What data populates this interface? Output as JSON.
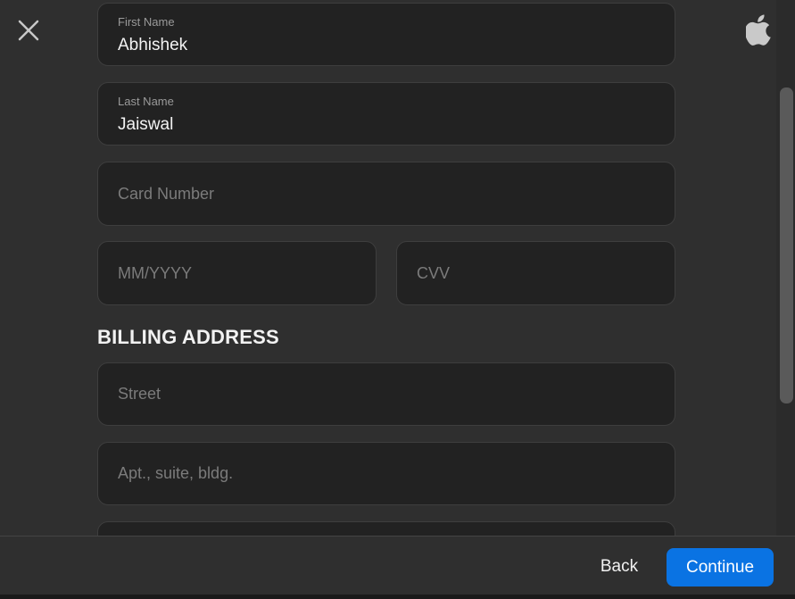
{
  "header": {
    "close_icon": "close-icon",
    "brand_icon": "apple-logo-icon"
  },
  "form": {
    "first_name": {
      "label": "First Name",
      "value": "Abhishek"
    },
    "last_name": {
      "label": "Last Name",
      "value": "Jaiswal"
    },
    "card_number": {
      "placeholder": "Card Number",
      "value": ""
    },
    "expiry": {
      "placeholder": "MM/YYYY",
      "value": ""
    },
    "cvv": {
      "placeholder": "CVV",
      "value": ""
    },
    "billing_heading": "BILLING ADDRESS",
    "street": {
      "placeholder": "Street",
      "value": ""
    },
    "apt": {
      "placeholder": "Apt., suite, bldg.",
      "value": ""
    }
  },
  "footer": {
    "back_label": "Back",
    "continue_label": "Continue"
  },
  "colors": {
    "background": "#2f2f2f",
    "field_background": "#222222",
    "accent": "#0a73e3"
  }
}
